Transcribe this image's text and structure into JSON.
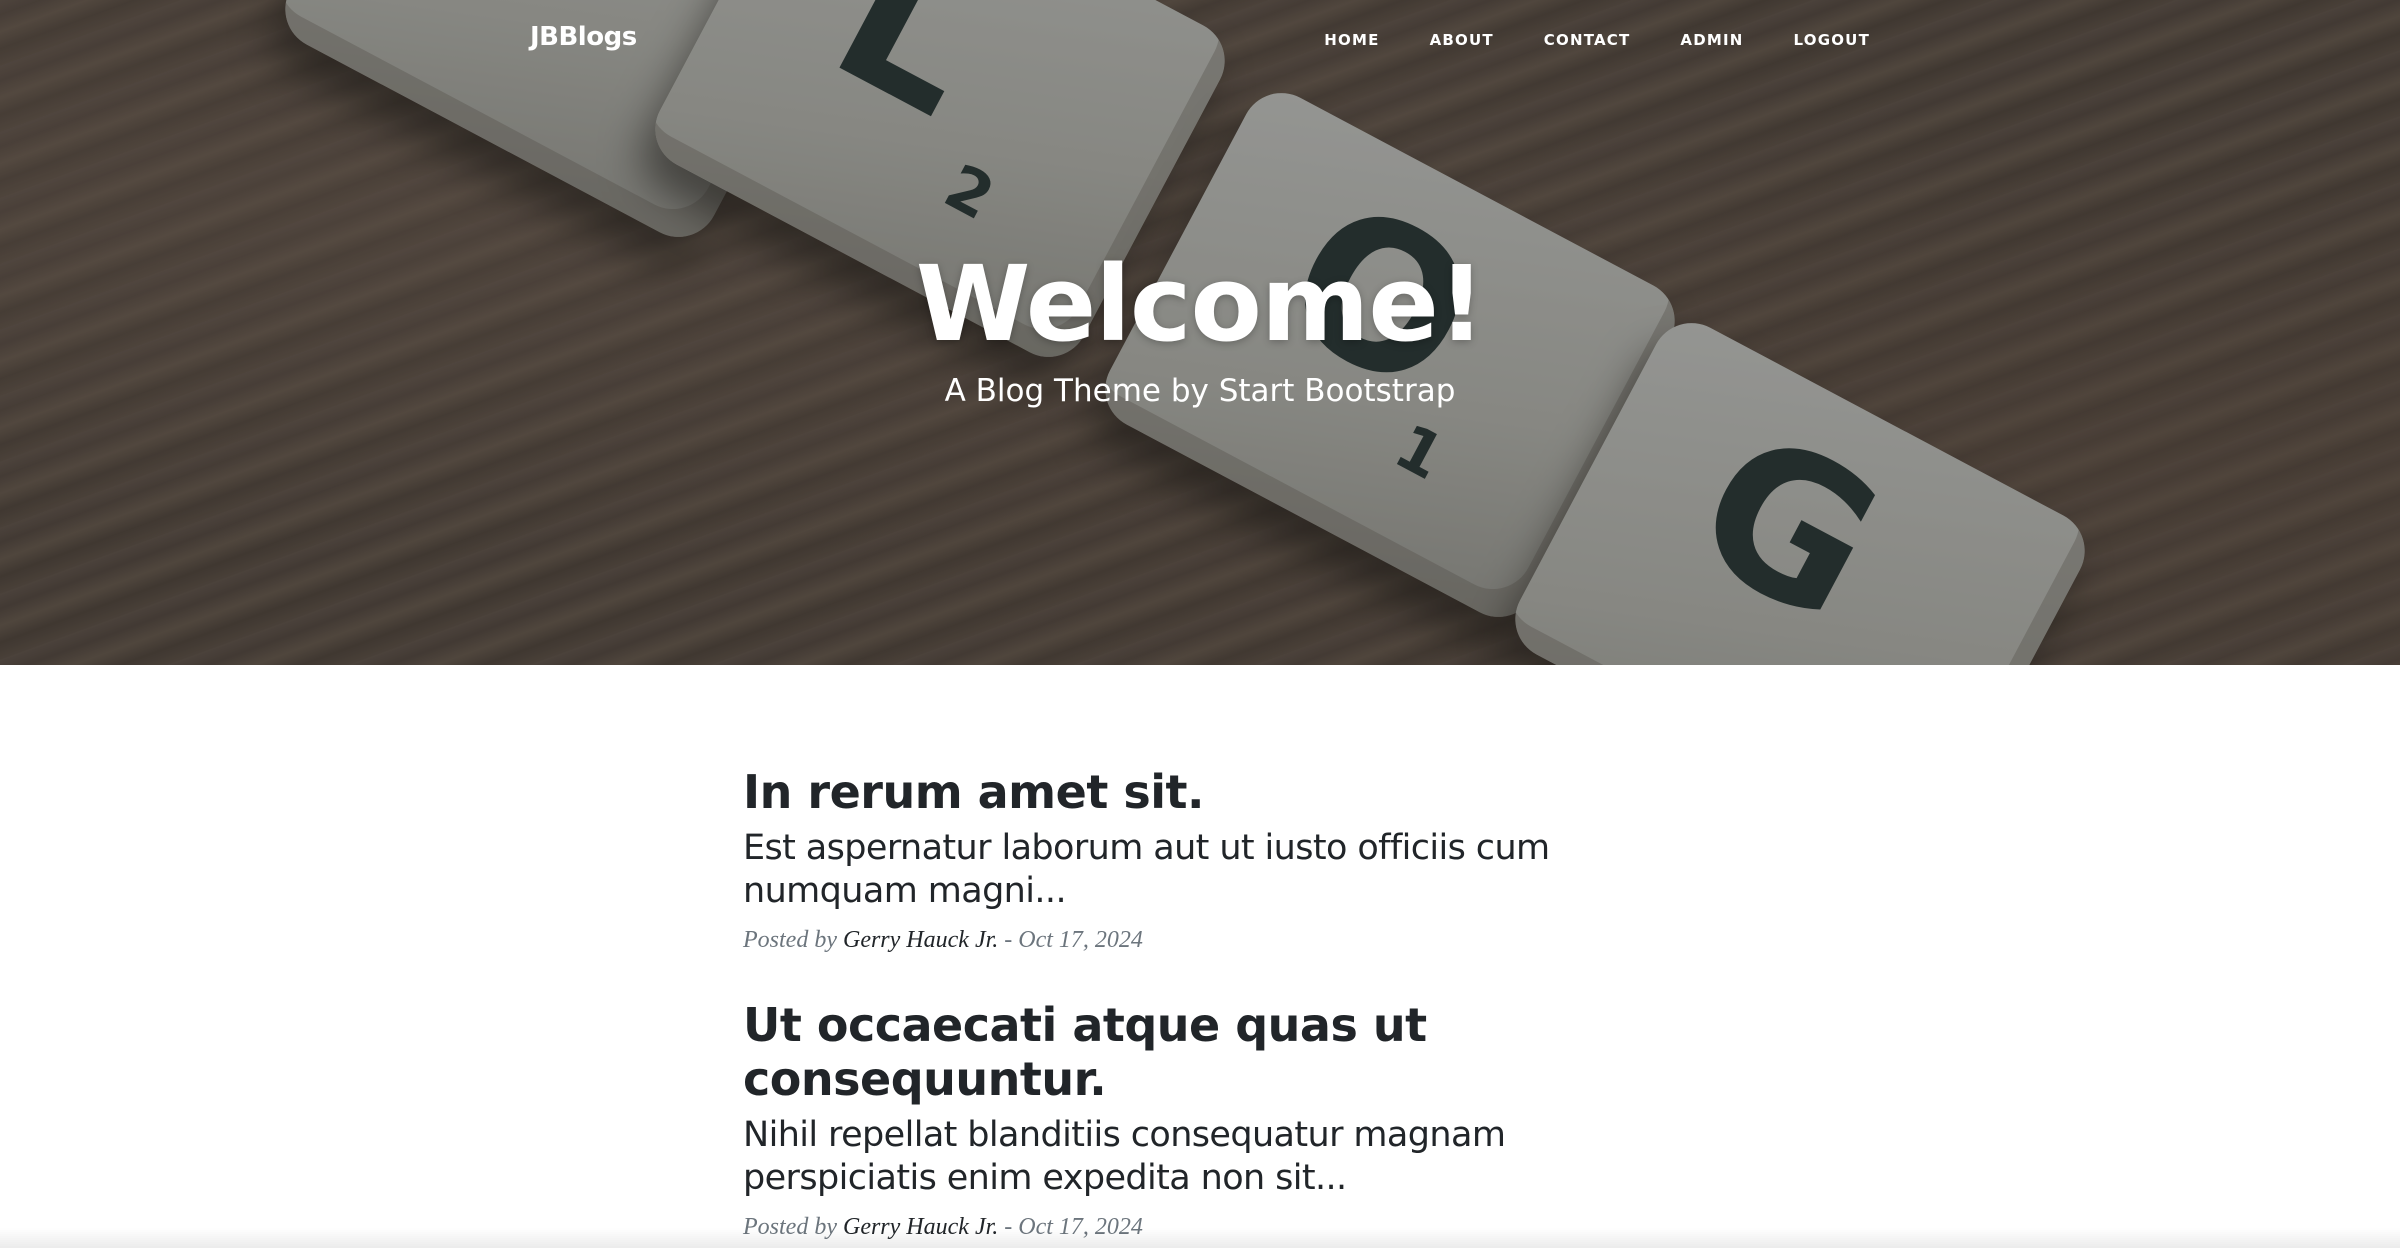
{
  "navbar": {
    "brand": "JBBlogs",
    "links": [
      {
        "label": "Home"
      },
      {
        "label": "About"
      },
      {
        "label": "Contact"
      },
      {
        "label": "Admin"
      },
      {
        "label": "Logout"
      }
    ]
  },
  "hero": {
    "title": "Welcome!",
    "subtitle": "A Blog Theme by Start Bootstrap",
    "tiles": [
      {
        "letter": "",
        "score": ""
      },
      {
        "letter": "L",
        "score": "2"
      },
      {
        "letter": "O",
        "score": "1"
      },
      {
        "letter": "G",
        "score": ""
      }
    ]
  },
  "posts": [
    {
      "title": "In rerum amet sit.",
      "subtitle": "Est aspernatur laborum aut ut iusto officiis cum numquam magni...",
      "posted_by_label": "Posted by",
      "author": "Gerry Hauck Jr.",
      "separator": " - ",
      "date": "Oct 17, 2024"
    },
    {
      "title": "Ut occaecati atque quas ut consequuntur.",
      "subtitle": "Nihil repellat blanditiis consequatur magnam perspiciatis enim expedita non sit...",
      "posted_by_label": "Posted by",
      "author": "Gerry Hauck Jr.",
      "separator": " - ",
      "date": "Oct 17, 2024"
    }
  ]
}
